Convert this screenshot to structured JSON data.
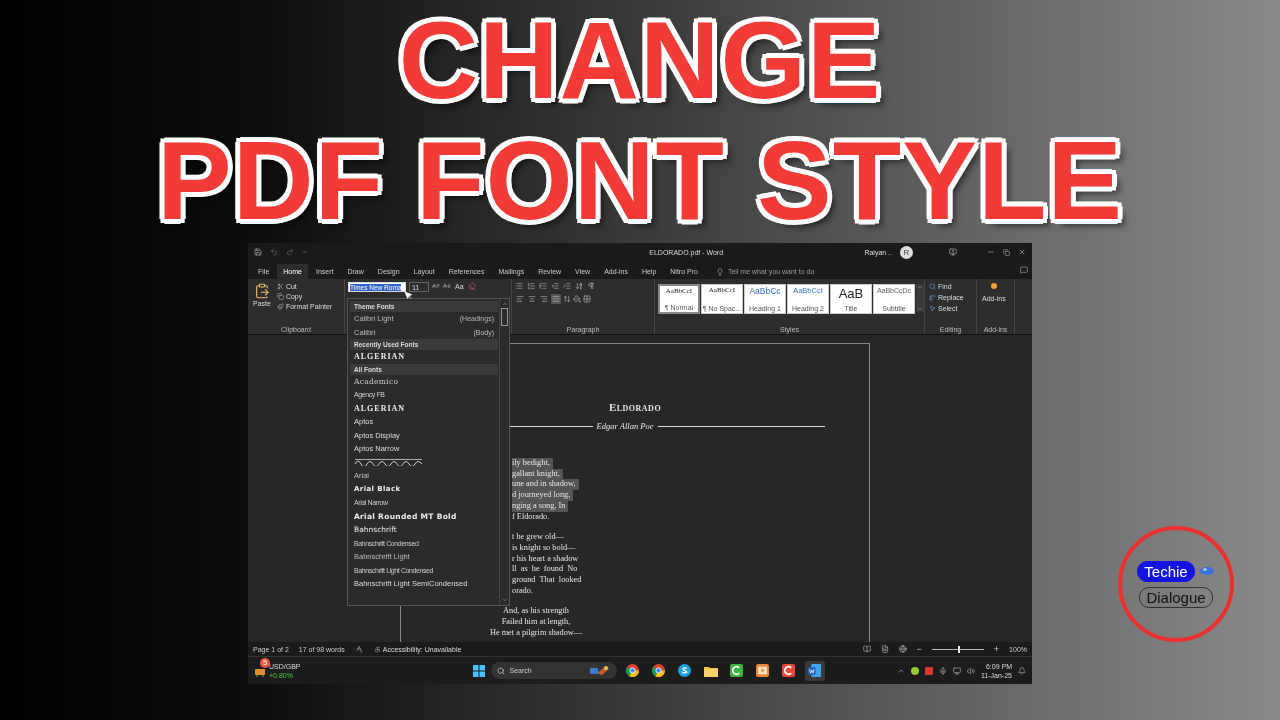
{
  "headline": [
    "CHANGE",
    "PDF FONT STYLE"
  ],
  "window": {
    "title": "ELDORADO.pdf - Word",
    "user": "Raiyan ..",
    "avatar": "R"
  },
  "tabs": [
    {
      "label": "File",
      "selected": false
    },
    {
      "label": "Home",
      "selected": true
    },
    {
      "label": "Insert",
      "selected": false
    },
    {
      "label": "Draw",
      "selected": false
    },
    {
      "label": "Design",
      "selected": false
    },
    {
      "label": "Layout",
      "selected": false
    },
    {
      "label": "References",
      "selected": false
    },
    {
      "label": "Mailings",
      "selected": false
    },
    {
      "label": "Review",
      "selected": false
    },
    {
      "label": "View",
      "selected": false
    },
    {
      "label": "Add-ins",
      "selected": false
    },
    {
      "label": "Help",
      "selected": false
    },
    {
      "label": "Nitro Pro",
      "selected": false
    }
  ],
  "tell_me": {
    "placeholder": "Tell me what you want to do"
  },
  "ribbon": {
    "clipboard": {
      "paste": "Paste",
      "items": [
        "Cut",
        "Copy",
        "Format Painter"
      ],
      "label": "Clipboard"
    },
    "font": {
      "name": "Times New Roma",
      "size": "11",
      "case": "Aa"
    },
    "paragraph": {
      "alignments": [
        {
          "selected": false
        },
        {
          "selected": false
        },
        {
          "selected": false
        },
        {
          "selected": true
        }
      ],
      "label": "Paragraph"
    },
    "styles": {
      "items": [
        {
          "preview": "AaBbCcI",
          "label": "¶ Normal",
          "kind": "body",
          "selected": true
        },
        {
          "preview": "AaBbCcI",
          "label": "¶ No Spac...",
          "kind": "body",
          "selected": false
        },
        {
          "preview": "AaBbCc",
          "label": "Heading 1",
          "kind": "heading1",
          "selected": false
        },
        {
          "preview": "AaBbCcI",
          "label": "Heading 2",
          "kind": "heading2",
          "selected": false
        },
        {
          "preview": "AaB",
          "label": "Title",
          "kind": "title",
          "selected": false
        },
        {
          "preview": "AaBbCcDc",
          "label": "Subtitle",
          "kind": "subtitle",
          "selected": false
        }
      ],
      "label": "Styles"
    },
    "editing": {
      "items": [
        "Find",
        "Replace",
        "Select"
      ],
      "label": "Editing"
    },
    "add_ins": {
      "button": "Add-ins",
      "label": "Add-ins"
    }
  },
  "font_menu": {
    "sections": [
      {
        "header": "Theme Fonts",
        "fonts": [
          {
            "name": "Calibri Light",
            "note": "(Headings)",
            "kind": "light"
          },
          {
            "name": "Calibri",
            "note": "(Body)",
            "kind": "light"
          }
        ]
      },
      {
        "header": "Recently Used Fonts",
        "fonts": [
          {
            "name": "ALGERIAN",
            "kind": "decorative"
          }
        ]
      },
      {
        "header": "All Fonts",
        "fonts": [
          {
            "name": "Academico",
            "kind": "serif"
          },
          {
            "name": "Agency FB",
            "kind": "narrow"
          },
          {
            "name": "ALGERIAN",
            "kind": "decorative"
          },
          {
            "name": "Aptos",
            "kind": "regular"
          },
          {
            "name": "Aptos Display",
            "kind": "regular"
          },
          {
            "name": "Aptos Narrow",
            "kind": "regular"
          },
          {
            "kind": "script"
          },
          {
            "name": "Arial",
            "kind": "light"
          },
          {
            "name": "Arial Black",
            "kind": "black"
          },
          {
            "name": "Arial Narrow",
            "kind": "narrow"
          },
          {
            "name": "Arial Rounded MT Bold",
            "kind": "bold"
          },
          {
            "name": "Bahnschrift",
            "kind": "medium"
          },
          {
            "name": "Bahnschrift Condensed",
            "kind": "narrow"
          },
          {
            "name": "Bahnschrift Light",
            "kind": "light"
          },
          {
            "name": "Bahnschrift Light Condensed",
            "kind": "narrow"
          },
          {
            "name": "Bahnschrift Light SemiCondensed",
            "kind": "regular"
          }
        ]
      }
    ]
  },
  "document": {
    "title": "Eldorado",
    "author": "Edgar Allan Poe",
    "stanzas": [
      {
        "kind": "cut",
        "lines": [
          {
            "text": "ily bedight,",
            "highlighted": true
          },
          {
            "text": "gallant knight,",
            "highlighted": true
          },
          {
            "text": "une and in shadow,",
            "highlighted": true
          },
          {
            "text": "d journeyed long,",
            "highlighted": true
          },
          {
            "text": "nging a song, In",
            "highlighted": true
          },
          {
            "text": "f Eldorado.",
            "highlighted": false
          }
        ]
      },
      {
        "kind": "cut",
        "lines": [
          {
            "text": "t he grew old—",
            "highlighted": false
          },
          {
            "text": "is knight so bold—",
            "highlighted": false
          },
          {
            "text": "r his heart a shadow",
            "highlighted": false
          },
          {
            "text": "ll  as  he  found  No",
            "highlighted": false
          },
          {
            "text": "ground  That  looked",
            "highlighted": false
          },
          {
            "text": "orado.",
            "highlighted": false
          }
        ]
      },
      {
        "kind": "center",
        "lines": [
          {
            "text": "And, as his strength",
            "highlighted": false
          },
          {
            "text": "Failed him at length,",
            "highlighted": false
          },
          {
            "text": "He met a pilgrim shadow—",
            "highlighted": false
          }
        ]
      }
    ]
  },
  "status_bar": {
    "page": "Page 1 of 2",
    "words": "17 of 98 words",
    "accessibility": "Accessibility: Unavailable",
    "zoom_out": "−",
    "zoom_in": "+",
    "zoom": "100%",
    "level": 0.5
  },
  "taskbar": {
    "widget": {
      "badge": "5",
      "title": "USD/GBP",
      "change": "+0.80%"
    },
    "search": "Search",
    "apps": [
      {
        "kind": "chrome",
        "selected": false
      },
      {
        "kind": "chrome",
        "selected": false
      },
      {
        "kind": "skype",
        "selected": false
      },
      {
        "kind": "folder",
        "selected": false
      },
      {
        "kind": "camtasia",
        "selected": false
      },
      {
        "kind": "player",
        "selected": false
      },
      {
        "kind": "recorder",
        "selected": false
      },
      {
        "kind": "word",
        "selected": true
      }
    ],
    "time": "6:09 PM",
    "date": "11-Jan-25"
  },
  "logo": {
    "top": "Techie",
    "bottom": "Dialogue"
  }
}
